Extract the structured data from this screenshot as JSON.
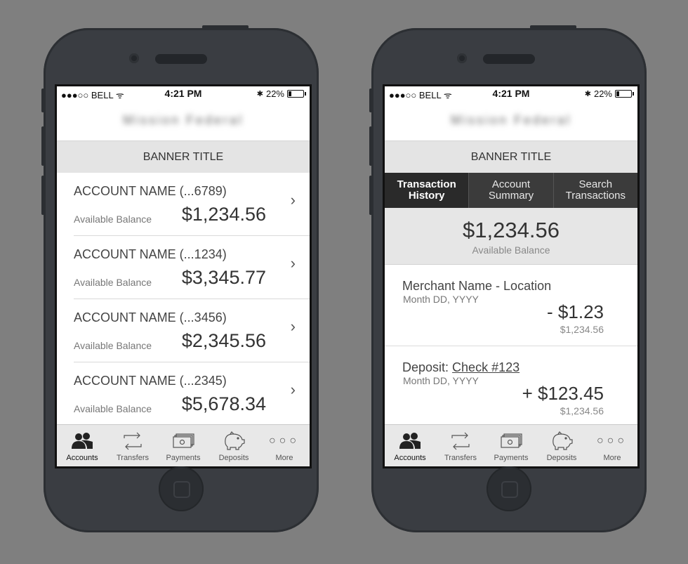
{
  "status": {
    "carrier": "●●●○○ BELL",
    "time": "4:21 PM",
    "battery_text": "22%",
    "battery_level": 0.22
  },
  "header": {
    "logo_text": "Mission Federal"
  },
  "banner": {
    "title": "BANNER TITLE"
  },
  "accounts": [
    {
      "name": "ACCOUNT NAME (...6789)",
      "balance_label": "Available Balance",
      "balance": "$1,234.56"
    },
    {
      "name": "ACCOUNT NAME (...1234)",
      "balance_label": "Available Balance",
      "balance": "$3,345.77"
    },
    {
      "name": "ACCOUNT NAME (...3456)",
      "balance_label": "Available Balance",
      "balance": "$2,345.56"
    },
    {
      "name": "ACCOUNT NAME (...2345)",
      "balance_label": "Available Balance",
      "balance": "$5,678.34"
    }
  ],
  "tabbar": {
    "items": [
      {
        "label": "Accounts",
        "icon": "accounts-icon",
        "active": true
      },
      {
        "label": "Transfers",
        "icon": "transfers-icon"
      },
      {
        "label": "Payments",
        "icon": "payments-icon"
      },
      {
        "label": "Deposits",
        "icon": "deposits-icon"
      },
      {
        "label": "More",
        "icon": "more-icon"
      }
    ]
  },
  "detail": {
    "segments": [
      {
        "label_line1": "Transaction",
        "label_line2": "History",
        "active": true
      },
      {
        "label_line1": "Account",
        "label_line2": "Summary"
      },
      {
        "label_line1": "Search",
        "label_line2": "Transactions"
      }
    ],
    "summary": {
      "balance": "$1,234.56",
      "label": "Available Balance"
    },
    "transactions": [
      {
        "title": "Merchant Name - Location",
        "link": "",
        "date": "Month DD, YYYY",
        "amount": "- $1.23",
        "running": "$1,234.56"
      },
      {
        "title": "Deposit: ",
        "link": "Check #123",
        "date": "Month DD, YYYY",
        "amount": "+ $123.45",
        "running": "$1,234.56"
      }
    ]
  },
  "colors": {
    "background": "#7f7f7f",
    "phone_body": "#3a3d42",
    "segment_active": "#2a2a2a"
  }
}
